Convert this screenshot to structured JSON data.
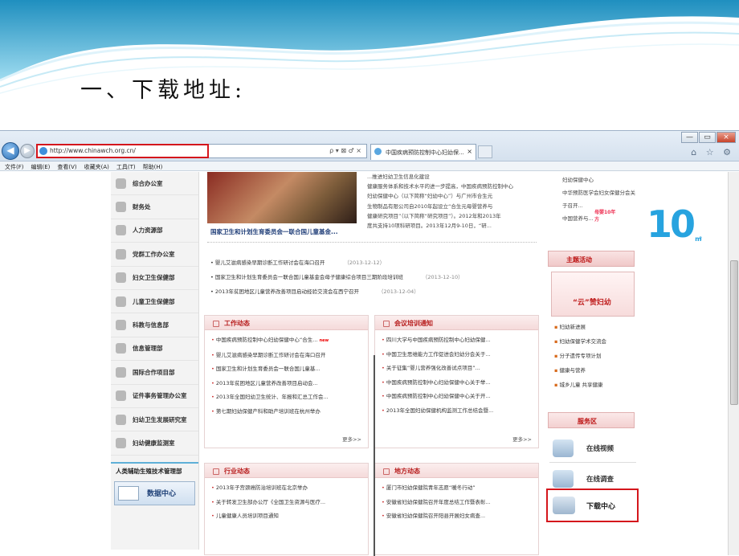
{
  "slide": {
    "title": "一、下载地址:"
  },
  "browser": {
    "url": "http://www.chinawch.org.cn/",
    "addr_tools": "ρ ▾ ⊠ ♂ ×",
    "tab_title": "中国疾病预防控制中心妇幼保...",
    "tab_close": "×",
    "win_controls": [
      "—",
      "▭",
      "×"
    ],
    "right_tools": "⌂ ☆ ⚙",
    "menu": [
      "文件(F)",
      "编辑(E)",
      "查看(V)",
      "收藏夹(A)",
      "工具(T)",
      "帮助(H)"
    ]
  },
  "left_nav": {
    "items": [
      "综合办公室",
      "财务处",
      "人力资源部",
      "党群工作办公室",
      "妇女卫生保健部",
      "儿童卫生保健部",
      "科教与信息部",
      "信息管理部",
      "国际合作项目部",
      "证件事务管理办公室",
      "妇幼卫生发展研究室",
      "妇幼健康监测室"
    ],
    "banner": "人类辅助生殖技术管理部",
    "data_center": "数据中心"
  },
  "main": {
    "news_caption": "国家卫生和计划生育委员会一联合国儿童基金...",
    "news_text": [
      "...推进妇幼卫生信息化建设",
      "健康服务体系和技术水平的进一步提高，中国疾病预防控制中心",
      "妇幼保健中心（以下简称“妇幼中心”）与广州市合生元",
      "生物制品有限公司自2010年起设立“合生元母婴营养与",
      "健康研究项目”（以下简称“研究项目”）。2012年和2013年",
      "度共支持10项科研项目。2013年12月9-10日，“研..."
    ],
    "news_list": [
      {
        "t": "婴儿艾滋病感染早期诊断工作研讨会在海口召开",
        "d": "（2013-12-12）"
      },
      {
        "t": "国家卫生和计划生育委员会一联合国儿童基金会母子健康综合项目三期阶段培训班",
        "d": "（2013-12-10）"
      },
      {
        "t": "2013年贫困地区儿童营养改善项目启动经验交流会在西宁召开",
        "d": "（2013-12-04）"
      }
    ],
    "work": {
      "title": "工作动态",
      "items": [
        "中国疾病预防控制中心妇幼保健中心“合生...",
        "婴儿艾滋病感染早期诊断工作研讨会在海口召开",
        "国家卫生和计划生育委员会一联合国儿童基...",
        "2013年贫困地区儿童营养改善项目启动会...",
        "2013年全国妇幼卫生统计、年报和汇总工作会...",
        "第七期妇幼保健产科和助产培训班在杭州举办"
      ],
      "new": "new",
      "more": "更多>>"
    },
    "meeting": {
      "title": "会议培训通知",
      "items": [
        "四川大学与中国疾病预防控制中心妇幼保健...",
        "中国卫生思维能力工作促进会妇幼分会关于...",
        "关于征集“婴儿营养强化改善试点项目”...",
        "中国疾病预防控制中心妇幼保健中心关于举...",
        "中国疾病预防控制中心妇幼保健中心关于开...",
        "2013年全国妇幼保健机构监测工作总结会暨..."
      ],
      "more": "更多>>"
    },
    "industry": {
      "title": "行业动态",
      "items": [
        "2013年子宫颈癌防治培训班在北京举办",
        "关于转发卫生部办公厅《全国卫生资源与医疗...",
        "儿童健康人员培训项目通知"
      ]
    },
    "local": {
      "title": "地方动态",
      "items": [
        "厦门市妇幼保健院青年志愿“暖冬行动”",
        "安徽省妇幼保健院召开年度总结工作暨表彰...",
        "安徽省妇幼保健院召开阳县开展妇女病查..."
      ]
    }
  },
  "right": {
    "top_links": [
      "妇幼保健中心",
      "中华预防医学会妇女保健分会关于召开...",
      "中国营养与..."
    ],
    "ten_label": "母婴10年方",
    "ten": "10",
    "ten_unit": "m²",
    "theme_title": "主题活动",
    "promo": "“云”赞妇幼",
    "links": [
      "妇幼新进展",
      "妇幼保健学术交流会",
      "分子遗传专项计划",
      "健康与营养",
      "城乡儿童 共享健康"
    ],
    "service_title": "服务区",
    "services": [
      "在线视频",
      "在线调查"
    ],
    "download": "下载中心"
  }
}
